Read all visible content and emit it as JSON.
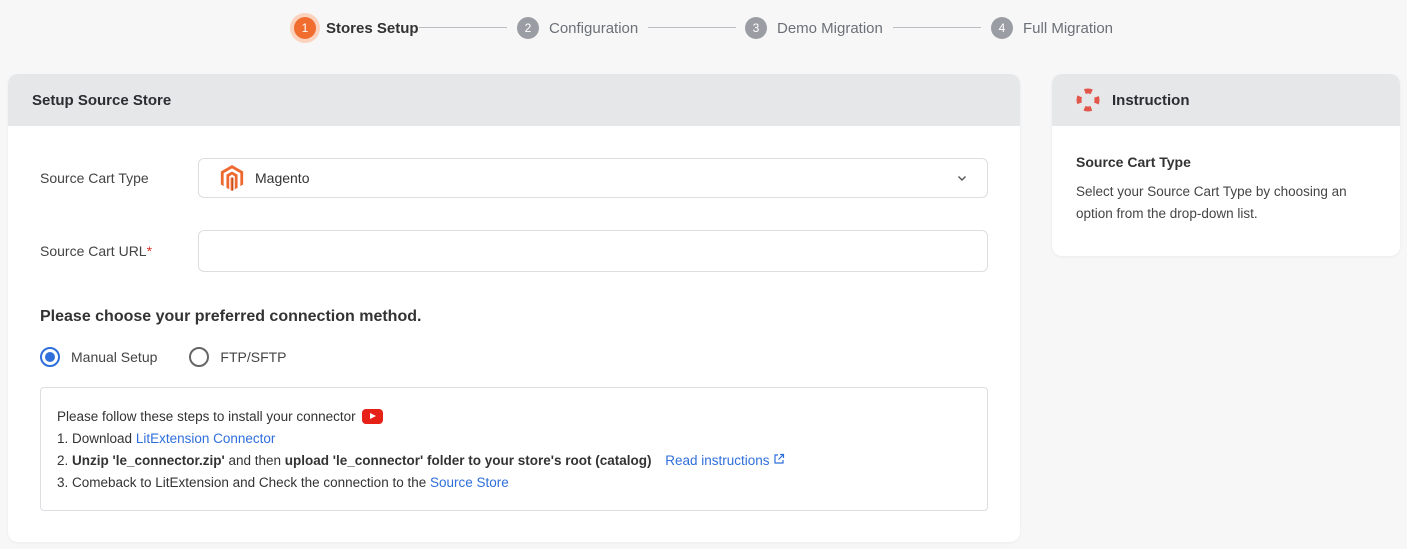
{
  "stepper": {
    "steps": [
      {
        "num": "1",
        "label": "Stores Setup",
        "active": true
      },
      {
        "num": "2",
        "label": "Configuration",
        "active": false
      },
      {
        "num": "3",
        "label": "Demo Migration",
        "active": false
      },
      {
        "num": "4",
        "label": "Full Migration",
        "active": false
      }
    ]
  },
  "main": {
    "title": "Setup Source Store",
    "cart_type_label": "Source Cart Type",
    "cart_type_value": "Magento",
    "cart_url_label": "Source Cart URL",
    "cart_url_required": "*",
    "cart_url_value": "",
    "connection_title": "Please choose your preferred connection method.",
    "radios": [
      {
        "label": "Manual Setup",
        "checked": true
      },
      {
        "label": "FTP/SFTP",
        "checked": false
      }
    ],
    "instructions": {
      "intro": "Please follow these steps to install your connector",
      "step1_prefix": "1. Download ",
      "step1_link": "LitExtension Connector",
      "step2_prefix": "2. ",
      "step2_bold1": "Unzip 'le_connector.zip'",
      "step2_mid": " and then ",
      "step2_bold2": "upload 'le_connector' folder to your store's root (catalog)",
      "step2_link": "Read instructions",
      "step3_prefix": "3. Comeback to LitExtension and Check the connection to the ",
      "step3_link": "Source Store"
    }
  },
  "side": {
    "title": "Instruction",
    "subtitle": "Source Cart Type",
    "text": "Select your Source Cart Type by choosing an option from the drop-down list."
  },
  "colors": {
    "accent": "#f16d2f",
    "link": "#2f6fdb",
    "magento": "#ee672f"
  },
  "icons": [
    "magento-logo-icon",
    "chevron-down-icon",
    "youtube-icon",
    "external-link-icon",
    "lifebuoy-icon"
  ]
}
